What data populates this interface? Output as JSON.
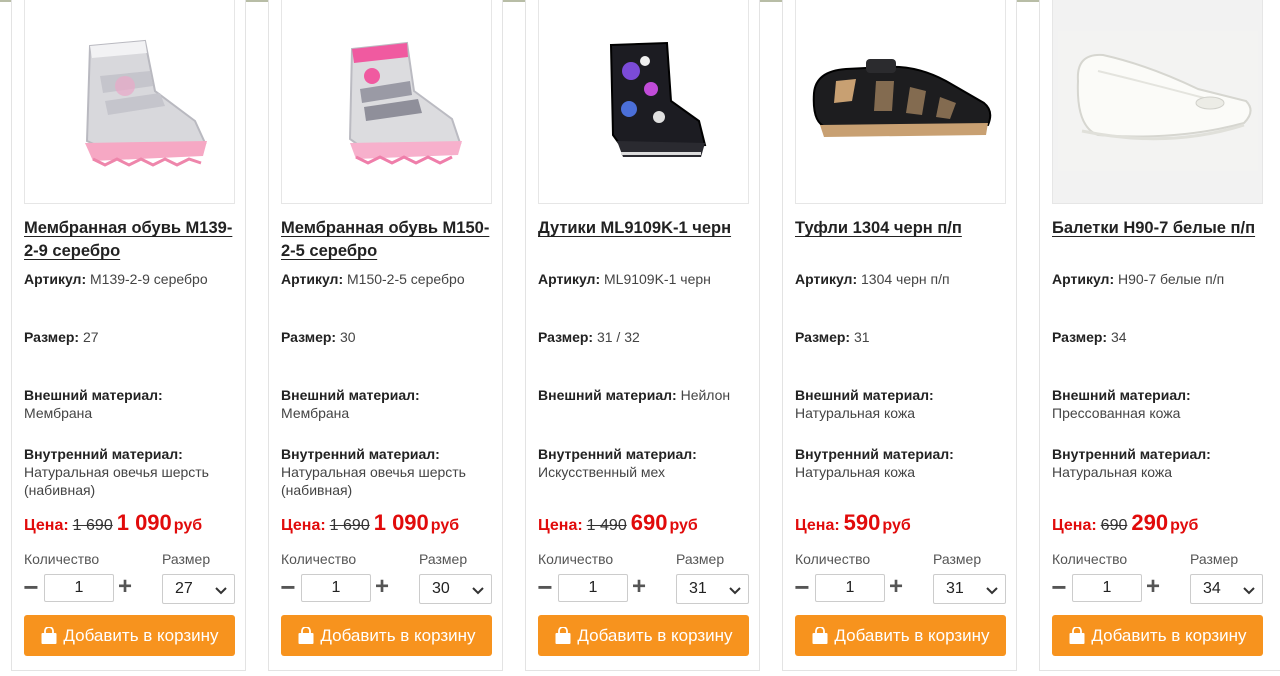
{
  "labels": {
    "article": "Артикул:",
    "size": "Размер:",
    "outer": "Внешний материал:",
    "inner": "Внутренний материал:",
    "price": "Цена:",
    "quantity": "Количество",
    "size_select": "Размер",
    "add_to_cart": "Добавить в корзину",
    "currency": "руб"
  },
  "colors": {
    "accent": "#f7931e",
    "price": "#e10b0b"
  },
  "products": [
    {
      "title": "Мембранная обувь М139-2-9 серебро",
      "article": "М139-2-9 серебро",
      "size": "27",
      "outer": "Мембрана",
      "inner": "Натуральная овечья шерсть (набивная)",
      "old_price": "1 690",
      "price": "1 090",
      "qty": "1",
      "size_selected": "27",
      "image": "silver-pink-winter-boot"
    },
    {
      "title": "Мембранная обувь М150-2-5 серебро",
      "article": "М150-2-5 серебро",
      "size": "30",
      "outer": "Мембрана",
      "inner": "Натуральная овечья шерсть (набивная)",
      "old_price": "1 690",
      "price": "1 090",
      "qty": "1",
      "size_selected": "30",
      "image": "silver-pink-winter-boot-2"
    },
    {
      "title": "Дутики ML9109K-1 черн",
      "article": "ML9109K-1 черн",
      "size": "31 / 32",
      "outer": "Нейлон",
      "inner": "Искусственный мех",
      "old_price": "1 490",
      "price": "690",
      "qty": "1",
      "size_selected": "31",
      "image": "black-moon-boot"
    },
    {
      "title": "Туфли 1304 черн п/п",
      "article": "1304 черн п/п",
      "size": "31",
      "outer": "Натуральная кожа",
      "inner": "Натуральная кожа",
      "old_price": "",
      "price": "590",
      "qty": "1",
      "size_selected": "31",
      "image": "black-sandal-shoe"
    },
    {
      "title": "Балетки Н90-7 белые п/п",
      "article": "Н90-7 белые п/п",
      "size": "34",
      "outer": "Прессованная кожа",
      "inner": "Натуральная кожа",
      "old_price": "690",
      "price": "290",
      "qty": "1",
      "size_selected": "34",
      "image": "white-ballet-flat"
    }
  ]
}
